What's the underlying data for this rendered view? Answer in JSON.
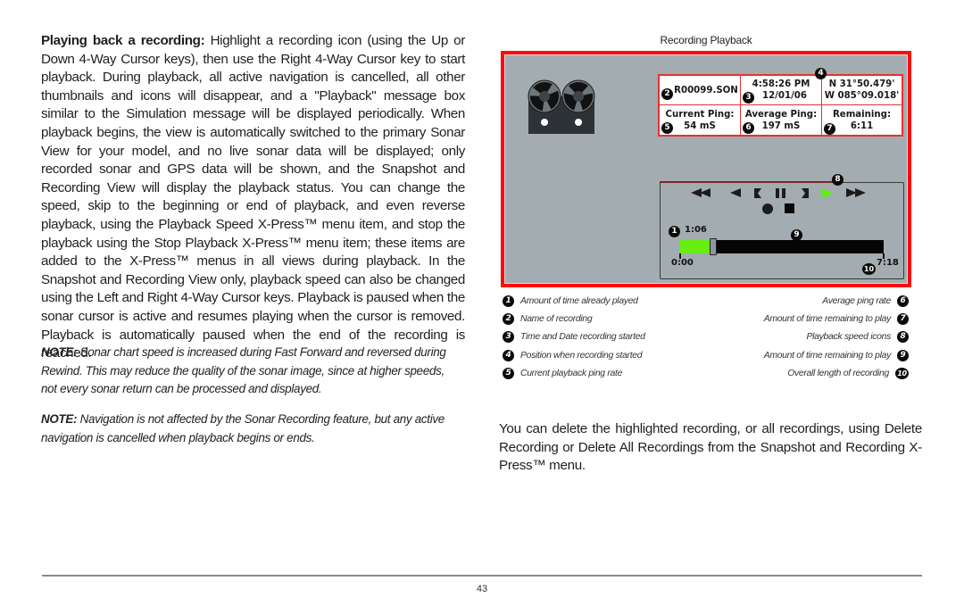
{
  "left_column": {
    "paragraph_heading": "Playing back a recording:",
    "paragraph_body": " Highlight a recording icon (using the Up or Down 4-Way Cursor keys), then use the Right 4-Way Cursor key to start playback. During playback, all active navigation is cancelled, all other thumbnails and icons will disappear, and a \"Playback\" message box similar to the Simulation message will be displayed periodically. When playback begins, the view is automatically switched to the primary Sonar View for your model, and no live sonar data will be displayed; only recorded sonar and GPS data will be shown, and the Snapshot and Recording View will display the playback status. You can change the speed, skip to the beginning or end of playback, and even reverse playback, using the Playback Speed X-Press™ menu item, and stop the playback using the Stop Playback X-Press™ menu item; these items are added to the X-Press™ menus in all views during playback. In the Snapshot and Recording View only, playback speed can also be changed using the Left and Right 4-Way Cursor keys. Playback is paused when the sonar cursor is active and resumes playing when the cursor is removed. Playback is automatically paused when the end of the recording is reached.",
    "notes": [
      {
        "label": "NOTE:",
        "text": " Sonar chart speed is increased during Fast Forward and reversed during Rewind. This may reduce the quality of the sonar image, since at higher speeds, not every sonar return can be processed and displayed."
      },
      {
        "label": "NOTE:",
        "text": " Navigation is not affected by the Sonar Recording feature, but any active navigation is cancelled when playback begins or ends."
      }
    ]
  },
  "figure": {
    "caption": "Recording Playback",
    "info_table": {
      "recording_name": "R00099.SON",
      "time": "4:58:26 PM",
      "date": "12/01/06",
      "lat": "N 31°50.479'",
      "lon": "W 085°09.018'",
      "current_ping_label": "Current Ping:",
      "current_ping_value": "54 mS",
      "average_ping_label": "Average Ping:",
      "average_ping_value": "197 mS",
      "remaining_label": "Remaining:",
      "remaining_value": "6:11"
    },
    "controls": {
      "icons": [
        "rewind-icon",
        "reverse-play-icon",
        "skip-back-icon",
        "pause-icon",
        "skip-forward-icon",
        "play-icon",
        "fast-forward-icon",
        "record-icon",
        "stop-icon"
      ],
      "active_icon": "play-icon",
      "active_color": "#66ee11",
      "elapsed": "1:06",
      "start": "0:00",
      "total": "7:18",
      "progress_fraction": 0.15
    },
    "callouts": [
      "1",
      "2",
      "3",
      "4",
      "5",
      "6",
      "7",
      "8",
      "9",
      "10"
    ],
    "colors": {
      "frame": "#ff0a0a",
      "screen": "#a3acb1",
      "progress": "#66ee11"
    }
  },
  "legend": {
    "left": [
      {
        "num": "1",
        "text": "Amount of time already played"
      },
      {
        "num": "2",
        "text": "Name of recording"
      },
      {
        "num": "3",
        "text": "Time and Date recording started"
      },
      {
        "num": "4",
        "text": "Position when recording started"
      },
      {
        "num": "5",
        "text": "Current playback ping rate"
      }
    ],
    "right": [
      {
        "num": "6",
        "text": "Average ping rate"
      },
      {
        "num": "7",
        "text": "Amount of time remaining to play"
      },
      {
        "num": "8",
        "text": "Playback speed icons"
      },
      {
        "num": "9",
        "text": "Amount of time remaining to play"
      },
      {
        "num": "10",
        "text": "Overall length of recording"
      }
    ]
  },
  "right_column": {
    "paragraph": "You can delete the highlighted recording, or all recordings, using Delete Recording or Delete All Recordings from the Snapshot and Recording X-Press™ menu."
  },
  "footer": {
    "page_number": "43"
  }
}
